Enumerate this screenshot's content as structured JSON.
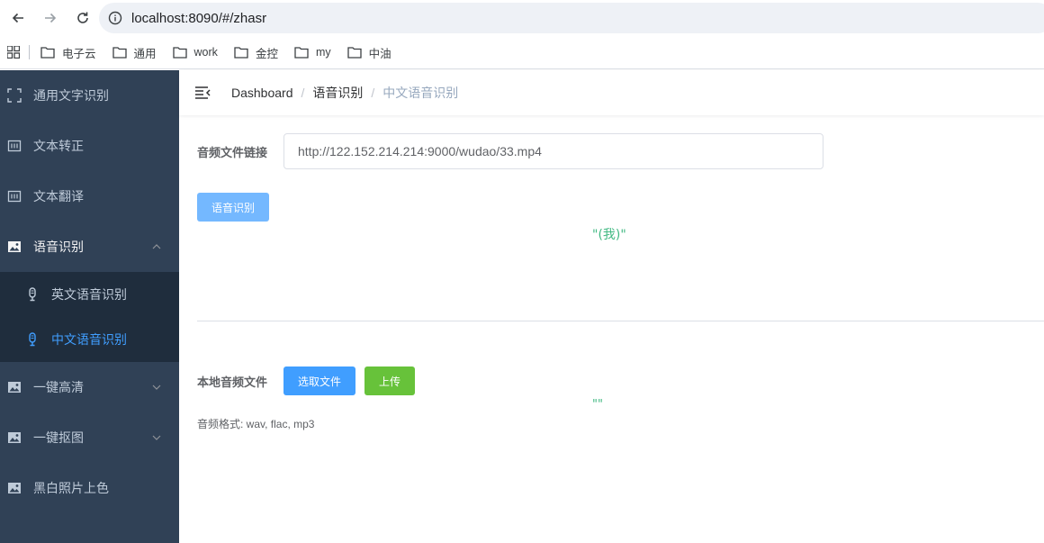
{
  "browser": {
    "url": "localhost:8090/#/zhasr",
    "bookmarks": [
      "电子云",
      "通用",
      "work",
      "金控",
      "my",
      "中油"
    ]
  },
  "sidebar": {
    "items": [
      {
        "label": "通用文字识别",
        "icon": "scan-icon"
      },
      {
        "label": "文本转正",
        "icon": "text-box-icon"
      },
      {
        "label": "文本翻译",
        "icon": "text-box-icon"
      },
      {
        "label": "语音识别",
        "icon": "image-icon",
        "expanded": true
      },
      {
        "label": "一键高清",
        "icon": "image-icon"
      },
      {
        "label": "一键抠图",
        "icon": "image-icon"
      },
      {
        "label": "黑白照片上色",
        "icon": "image-icon"
      }
    ],
    "subitems": [
      {
        "label": "英文语音识别",
        "icon": "microphone-icon"
      },
      {
        "label": "中文语音识别",
        "icon": "microphone-icon",
        "active": true
      }
    ],
    "active_color": "#409eff",
    "bg_color": "#304156"
  },
  "navbar": {
    "breadcrumb": [
      "Dashboard",
      "语音识别",
      "中文语音识别"
    ]
  },
  "url_form": {
    "label": "音频文件链接",
    "value": "http://122.152.214.214:9000/wudao/33.mp4",
    "button": "语音识别",
    "result": "\"(我)\""
  },
  "file_form": {
    "label": "本地音频文件",
    "select_button": "选取文件",
    "upload_button": "上传",
    "result": "\"\"",
    "hint": "音频格式: wav, flac, mp3"
  }
}
